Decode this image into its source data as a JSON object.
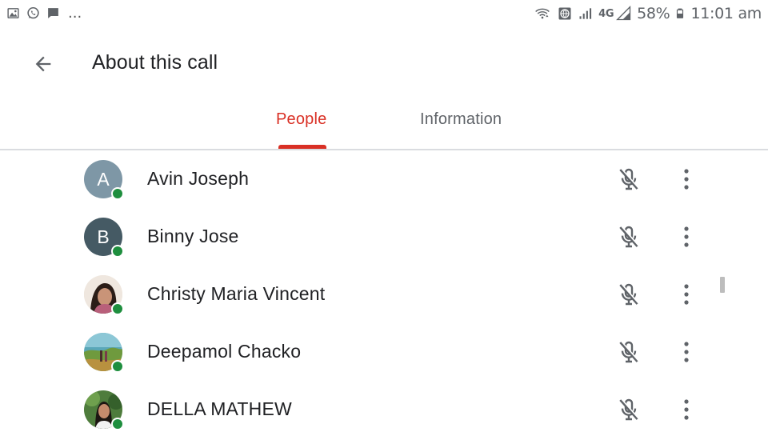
{
  "status_bar": {
    "left_icons": [
      "gallery-icon",
      "whatsapp-icon",
      "message-icon"
    ],
    "overflow": "...",
    "network_type": "4G",
    "battery": "58%",
    "time": "11:01 am"
  },
  "header": {
    "title": "About this call"
  },
  "tabs": [
    {
      "label": "People",
      "active": true
    },
    {
      "label": "Information",
      "active": false
    }
  ],
  "colors": {
    "accent": "#d93025",
    "presence": "#1e8e3e",
    "icon": "#5f6368"
  },
  "participants": [
    {
      "name": "Avin Joseph",
      "initial": "A",
      "avatar_color": "#7e97a6",
      "avatar_type": "initial",
      "online": true,
      "muted": true
    },
    {
      "name": "Binny Jose",
      "initial": "B",
      "avatar_color": "#455a64",
      "avatar_type": "initial",
      "online": true,
      "muted": true
    },
    {
      "name": "Christy Maria Vincent",
      "initial": "",
      "avatar_color": "#c9a48e",
      "avatar_type": "photo",
      "online": true,
      "muted": true
    },
    {
      "name": "Deepamol Chacko",
      "initial": "",
      "avatar_color": "#4c8f9a",
      "avatar_type": "photo",
      "online": true,
      "muted": true
    },
    {
      "name": "DELLA MATHEW",
      "initial": "",
      "avatar_color": "#3f6b3a",
      "avatar_type": "photo",
      "online": true,
      "muted": true
    }
  ]
}
